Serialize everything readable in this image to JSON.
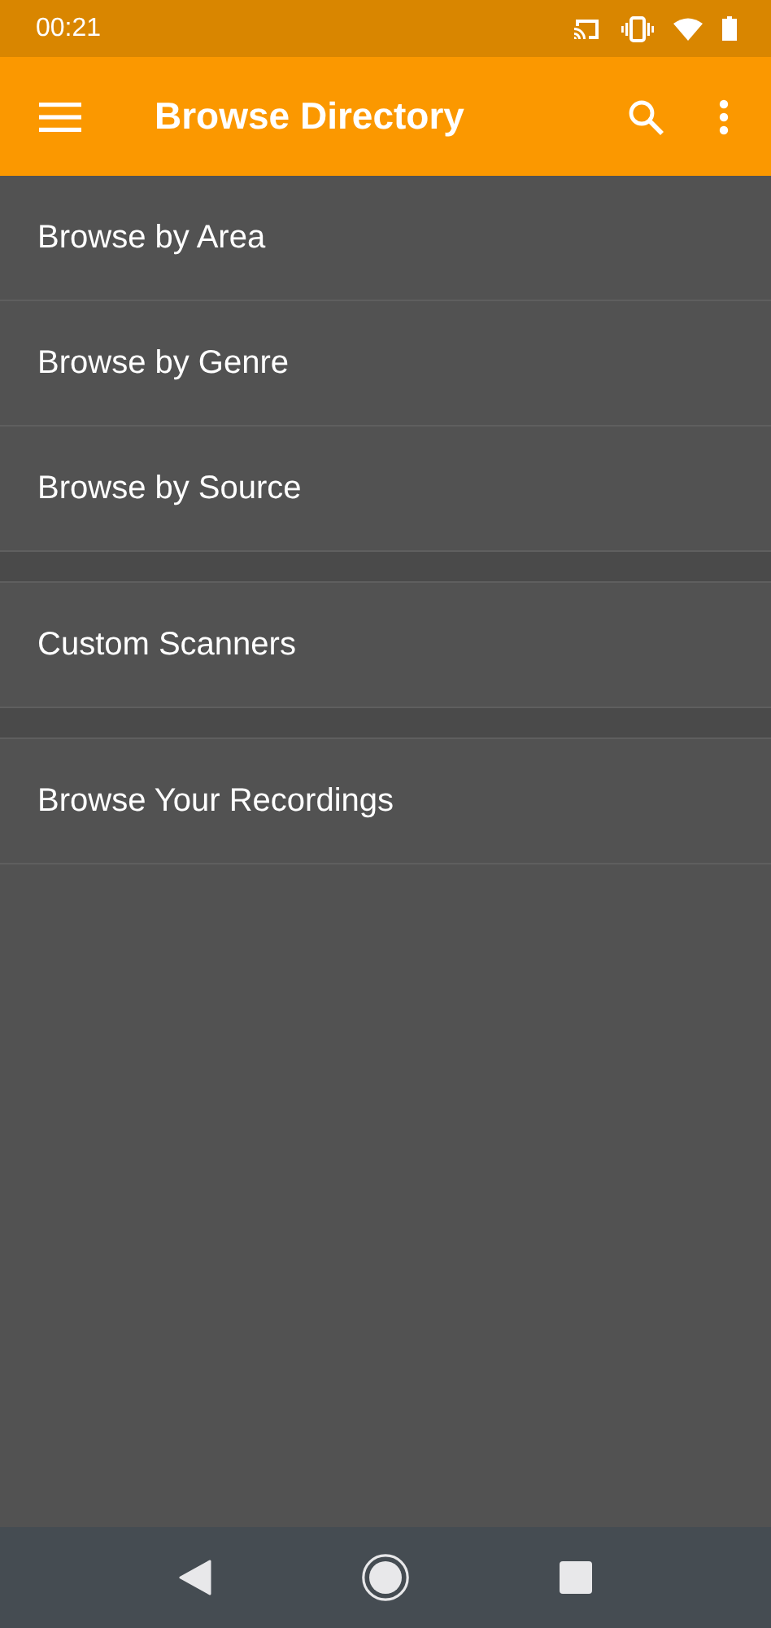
{
  "status_bar": {
    "time": "00:21"
  },
  "app_bar": {
    "title": "Browse Directory"
  },
  "sections": [
    {
      "items": [
        "Browse by Area",
        "Browse by Genre",
        "Browse by Source"
      ]
    },
    {
      "items": [
        "Custom Scanners"
      ]
    },
    {
      "items": [
        "Browse Your Recordings"
      ]
    }
  ]
}
